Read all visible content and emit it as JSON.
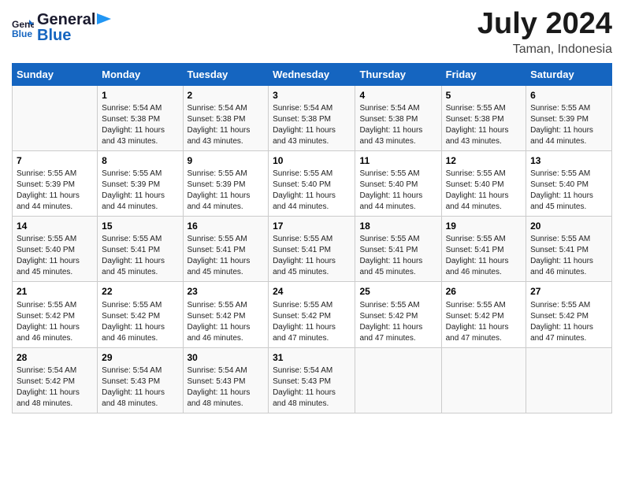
{
  "header": {
    "logo_line1": "General",
    "logo_line2": "Blue",
    "month_year": "July 2024",
    "location": "Taman, Indonesia"
  },
  "days_of_week": [
    "Sunday",
    "Monday",
    "Tuesday",
    "Wednesday",
    "Thursday",
    "Friday",
    "Saturday"
  ],
  "weeks": [
    [
      {
        "day": "",
        "info": ""
      },
      {
        "day": "1",
        "info": "Sunrise: 5:54 AM\nSunset: 5:38 PM\nDaylight: 11 hours\nand 43 minutes."
      },
      {
        "day": "2",
        "info": "Sunrise: 5:54 AM\nSunset: 5:38 PM\nDaylight: 11 hours\nand 43 minutes."
      },
      {
        "day": "3",
        "info": "Sunrise: 5:54 AM\nSunset: 5:38 PM\nDaylight: 11 hours\nand 43 minutes."
      },
      {
        "day": "4",
        "info": "Sunrise: 5:54 AM\nSunset: 5:38 PM\nDaylight: 11 hours\nand 43 minutes."
      },
      {
        "day": "5",
        "info": "Sunrise: 5:55 AM\nSunset: 5:38 PM\nDaylight: 11 hours\nand 43 minutes."
      },
      {
        "day": "6",
        "info": "Sunrise: 5:55 AM\nSunset: 5:39 PM\nDaylight: 11 hours\nand 44 minutes."
      }
    ],
    [
      {
        "day": "7",
        "info": "Sunrise: 5:55 AM\nSunset: 5:39 PM\nDaylight: 11 hours\nand 44 minutes."
      },
      {
        "day": "8",
        "info": "Sunrise: 5:55 AM\nSunset: 5:39 PM\nDaylight: 11 hours\nand 44 minutes."
      },
      {
        "day": "9",
        "info": "Sunrise: 5:55 AM\nSunset: 5:39 PM\nDaylight: 11 hours\nand 44 minutes."
      },
      {
        "day": "10",
        "info": "Sunrise: 5:55 AM\nSunset: 5:40 PM\nDaylight: 11 hours\nand 44 minutes."
      },
      {
        "day": "11",
        "info": "Sunrise: 5:55 AM\nSunset: 5:40 PM\nDaylight: 11 hours\nand 44 minutes."
      },
      {
        "day": "12",
        "info": "Sunrise: 5:55 AM\nSunset: 5:40 PM\nDaylight: 11 hours\nand 44 minutes."
      },
      {
        "day": "13",
        "info": "Sunrise: 5:55 AM\nSunset: 5:40 PM\nDaylight: 11 hours\nand 45 minutes."
      }
    ],
    [
      {
        "day": "14",
        "info": "Sunrise: 5:55 AM\nSunset: 5:40 PM\nDaylight: 11 hours\nand 45 minutes."
      },
      {
        "day": "15",
        "info": "Sunrise: 5:55 AM\nSunset: 5:41 PM\nDaylight: 11 hours\nand 45 minutes."
      },
      {
        "day": "16",
        "info": "Sunrise: 5:55 AM\nSunset: 5:41 PM\nDaylight: 11 hours\nand 45 minutes."
      },
      {
        "day": "17",
        "info": "Sunrise: 5:55 AM\nSunset: 5:41 PM\nDaylight: 11 hours\nand 45 minutes."
      },
      {
        "day": "18",
        "info": "Sunrise: 5:55 AM\nSunset: 5:41 PM\nDaylight: 11 hours\nand 45 minutes."
      },
      {
        "day": "19",
        "info": "Sunrise: 5:55 AM\nSunset: 5:41 PM\nDaylight: 11 hours\nand 46 minutes."
      },
      {
        "day": "20",
        "info": "Sunrise: 5:55 AM\nSunset: 5:41 PM\nDaylight: 11 hours\nand 46 minutes."
      }
    ],
    [
      {
        "day": "21",
        "info": "Sunrise: 5:55 AM\nSunset: 5:42 PM\nDaylight: 11 hours\nand 46 minutes."
      },
      {
        "day": "22",
        "info": "Sunrise: 5:55 AM\nSunset: 5:42 PM\nDaylight: 11 hours\nand 46 minutes."
      },
      {
        "day": "23",
        "info": "Sunrise: 5:55 AM\nSunset: 5:42 PM\nDaylight: 11 hours\nand 46 minutes."
      },
      {
        "day": "24",
        "info": "Sunrise: 5:55 AM\nSunset: 5:42 PM\nDaylight: 11 hours\nand 47 minutes."
      },
      {
        "day": "25",
        "info": "Sunrise: 5:55 AM\nSunset: 5:42 PM\nDaylight: 11 hours\nand 47 minutes."
      },
      {
        "day": "26",
        "info": "Sunrise: 5:55 AM\nSunset: 5:42 PM\nDaylight: 11 hours\nand 47 minutes."
      },
      {
        "day": "27",
        "info": "Sunrise: 5:55 AM\nSunset: 5:42 PM\nDaylight: 11 hours\nand 47 minutes."
      }
    ],
    [
      {
        "day": "28",
        "info": "Sunrise: 5:54 AM\nSunset: 5:42 PM\nDaylight: 11 hours\nand 48 minutes."
      },
      {
        "day": "29",
        "info": "Sunrise: 5:54 AM\nSunset: 5:43 PM\nDaylight: 11 hours\nand 48 minutes."
      },
      {
        "day": "30",
        "info": "Sunrise: 5:54 AM\nSunset: 5:43 PM\nDaylight: 11 hours\nand 48 minutes."
      },
      {
        "day": "31",
        "info": "Sunrise: 5:54 AM\nSunset: 5:43 PM\nDaylight: 11 hours\nand 48 minutes."
      },
      {
        "day": "",
        "info": ""
      },
      {
        "day": "",
        "info": ""
      },
      {
        "day": "",
        "info": ""
      }
    ]
  ]
}
